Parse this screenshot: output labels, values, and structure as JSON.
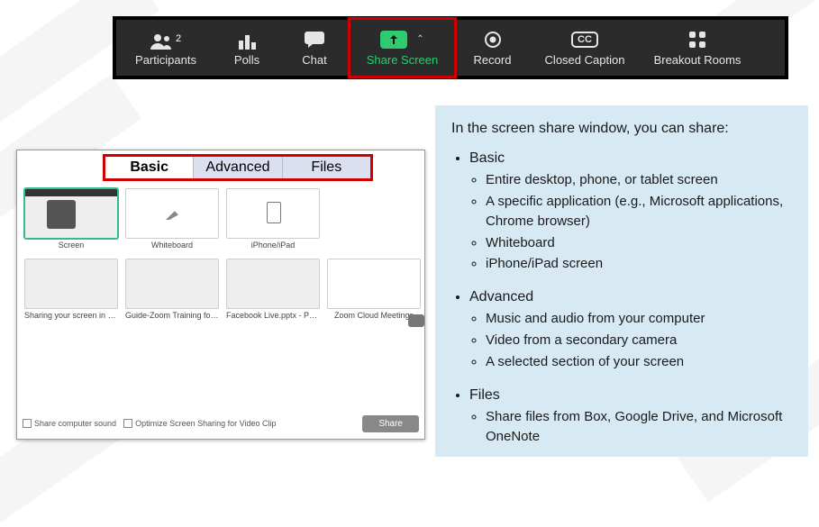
{
  "toolbar": {
    "participants": {
      "label": "Participants",
      "count": "2"
    },
    "polls": {
      "label": "Polls"
    },
    "chat": {
      "label": "Chat"
    },
    "share": {
      "label": "Share Screen"
    },
    "record": {
      "label": "Record"
    },
    "cc": {
      "label": "Closed Caption",
      "badge": "CC"
    },
    "breakout": {
      "label": "Breakout Rooms"
    }
  },
  "dialog": {
    "tabs": {
      "basic": "Basic",
      "advanced": "Advanced",
      "files": "Files"
    },
    "tiles": {
      "screen": "Screen",
      "whiteboard": "Whiteboard",
      "iphone": "iPhone/iPad",
      "t1": "Sharing your screen in a meeting ...",
      "t2": "Guide-Zoom Training for Fresh C...",
      "t3": "Facebook Live.pptx - PowerPoint",
      "t4": "Zoom Cloud Meetings"
    },
    "opts": {
      "sound": "Share computer sound",
      "optimize": "Optimize Screen Sharing for Video Clip"
    },
    "share_button": "Share"
  },
  "info": {
    "heading": "In the screen share window, you can share:",
    "basic_title": "Basic",
    "basic": [
      "Entire desktop, phone, or tablet screen",
      "A specific application (e.g., Microsoft applications, Chrome browser)",
      "Whiteboard",
      "iPhone/iPad screen"
    ],
    "advanced_title": "Advanced",
    "advanced": [
      "Music and audio from your computer",
      "Video from a secondary camera",
      "A selected section of your screen"
    ],
    "files_title": "Files",
    "files": [
      "Share files from Box, Google Drive, and Microsoft OneNote"
    ]
  }
}
